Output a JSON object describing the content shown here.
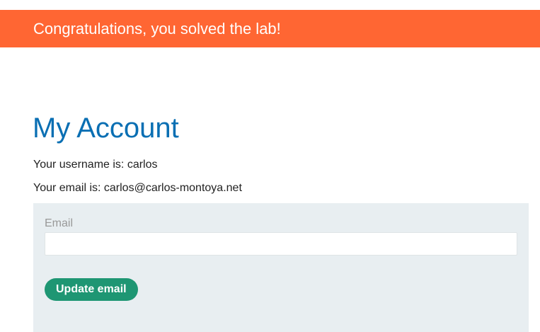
{
  "banner": {
    "message": "Congratulations, you solved the lab!"
  },
  "account": {
    "title": "My Account",
    "username_text": "Your username is: carlos",
    "email_text": "Your email is: carlos@carlos-montoya.net"
  },
  "form": {
    "email_label": "Email",
    "email_value": "",
    "update_button_label": "Update email"
  },
  "colors": {
    "banner_bg": "#ff6633",
    "title_color": "#0a6fb3",
    "panel_bg": "#e8eef1",
    "button_bg": "#1e9673"
  }
}
